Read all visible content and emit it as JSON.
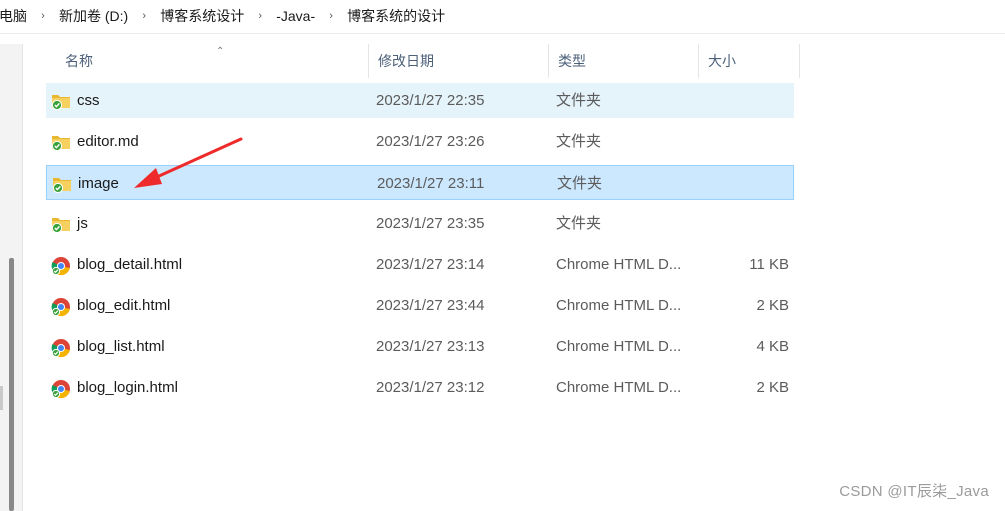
{
  "breadcrumb": {
    "items": [
      "电脑",
      "新加卷 (D:)",
      "博客系统设计",
      "-Java-",
      "博客系统的设计"
    ],
    "separator": "›"
  },
  "columns": {
    "name": "名称",
    "date": "修改日期",
    "type": "类型",
    "size": "大小"
  },
  "files": [
    {
      "name": "css",
      "date": "2023/1/27 22:35",
      "type": "文件夹",
      "size": "",
      "icon": "folder-icon",
      "state": "hover"
    },
    {
      "name": "editor.md",
      "date": "2023/1/27 23:26",
      "type": "文件夹",
      "size": "",
      "icon": "folder-icon",
      "state": ""
    },
    {
      "name": "image",
      "date": "2023/1/27 23:11",
      "type": "文件夹",
      "size": "",
      "icon": "folder-icon",
      "state": "selected"
    },
    {
      "name": "js",
      "date": "2023/1/27 23:35",
      "type": "文件夹",
      "size": "",
      "icon": "folder-icon",
      "state": ""
    },
    {
      "name": "blog_detail.html",
      "date": "2023/1/27 23:14",
      "type": "Chrome HTML D...",
      "size": "11 KB",
      "icon": "chrome-icon",
      "state": ""
    },
    {
      "name": "blog_edit.html",
      "date": "2023/1/27 23:44",
      "type": "Chrome HTML D...",
      "size": "2 KB",
      "icon": "chrome-icon",
      "state": ""
    },
    {
      "name": "blog_list.html",
      "date": "2023/1/27 23:13",
      "type": "Chrome HTML D...",
      "size": "4 KB",
      "icon": "chrome-icon",
      "state": ""
    },
    {
      "name": "blog_login.html",
      "date": "2023/1/27 23:12",
      "type": "Chrome HTML D...",
      "size": "2 KB",
      "icon": "chrome-icon",
      "state": ""
    }
  ],
  "annotation": {
    "color": "#ee2a2a",
    "points_to": "image"
  },
  "watermark": "CSDN @IT辰柒_Java",
  "colors": {
    "hover": "#e5f3fb",
    "selected": "#cce8ff",
    "selected_border": "#99d1ff",
    "header_text": "#4c607a"
  }
}
